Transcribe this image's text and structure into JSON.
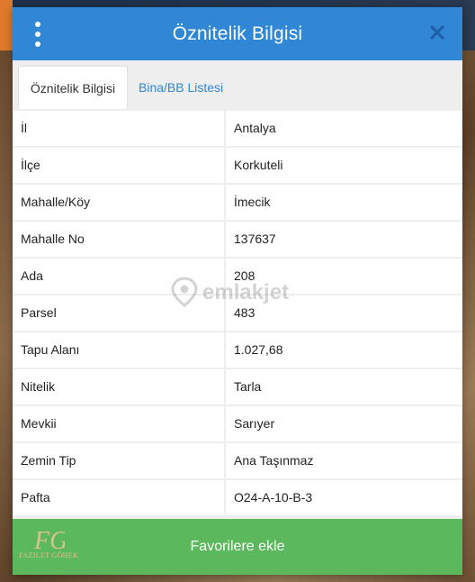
{
  "header": {
    "title": "Öznitelik Bilgisi"
  },
  "tabs": [
    {
      "label": "Öznitelik Bilgisi",
      "active": true
    },
    {
      "label": "Bina/BB Listesi",
      "active": false
    }
  ],
  "attributes": [
    {
      "key": "İl",
      "value": "Antalya"
    },
    {
      "key": "İlçe",
      "value": "Korkuteli"
    },
    {
      "key": "Mahalle/Köy",
      "value": "İmecik"
    },
    {
      "key": "Mahalle No",
      "value": "137637"
    },
    {
      "key": "Ada",
      "value": "208"
    },
    {
      "key": "Parsel",
      "value": "483"
    },
    {
      "key": "Tapu Alanı",
      "value": "1.027,68"
    },
    {
      "key": "Nitelik",
      "value": "Tarla"
    },
    {
      "key": "Mevkii",
      "value": "Sarıyer"
    },
    {
      "key": "Zemin Tip",
      "value": "Ana Taşınmaz"
    },
    {
      "key": "Pafta",
      "value": "O24-A-10-B-3"
    }
  ],
  "footer": {
    "button_label": "Favorilere ekle"
  },
  "watermark": {
    "text": "emlakjet"
  },
  "logo": {
    "initials": "FG",
    "name": "FAZILET GÖHER"
  },
  "colors": {
    "header": "#2f87d6",
    "tab_inactive_text": "#2f87d6",
    "footer": "#5cb85c",
    "row_divider": "#eeeeee"
  },
  "icons": [
    "more-vertical-icon",
    "close-icon",
    "location-pin-icon"
  ]
}
